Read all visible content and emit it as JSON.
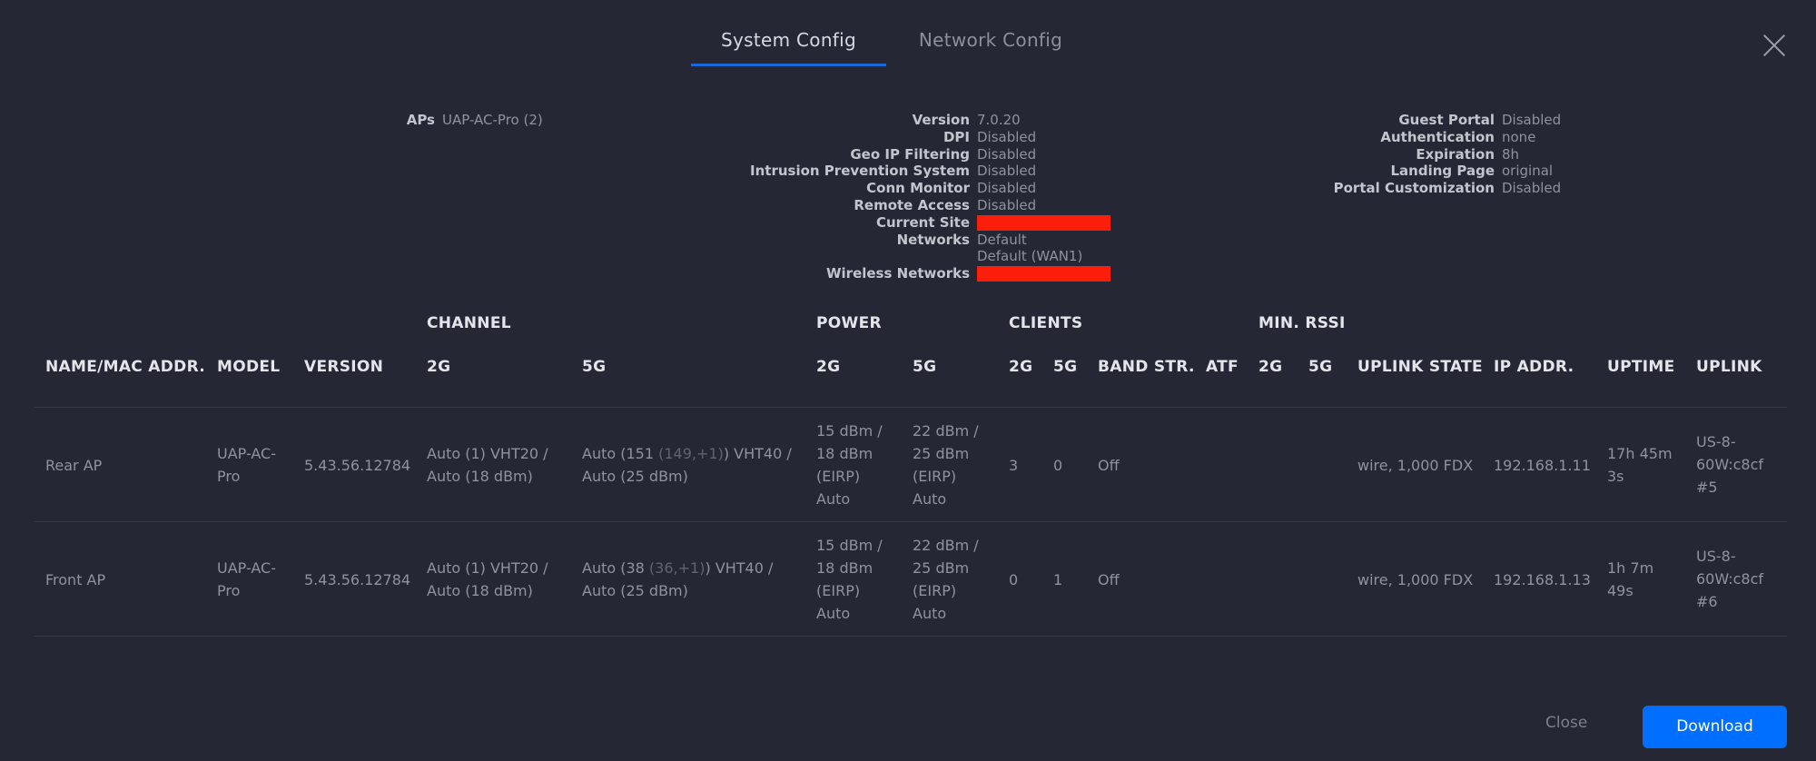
{
  "tabs": [
    {
      "label": "System Config"
    },
    {
      "label": "Network Config"
    }
  ],
  "info": {
    "col1": [
      {
        "label": "APs",
        "value": "UAP-AC-Pro (2)"
      }
    ],
    "col2": [
      {
        "label": "Version",
        "value": "7.0.20"
      },
      {
        "label": "DPI",
        "value": "Disabled"
      },
      {
        "label": "Geo IP Filtering",
        "value": "Disabled"
      },
      {
        "label": "Intrusion Prevention System",
        "value": "Disabled"
      },
      {
        "label": "Conn Monitor",
        "value": "Disabled"
      },
      {
        "label": "Remote Access",
        "value": "Disabled"
      },
      {
        "label": "Current Site",
        "value": ""
      },
      {
        "label": "Networks",
        "value": "Default"
      },
      {
        "label": "",
        "value": "Default (WAN1)"
      },
      {
        "label": "Wireless Networks",
        "value": ""
      }
    ],
    "col3": [
      {
        "label": "Guest Portal",
        "value": "Disabled"
      },
      {
        "label": "Authentication",
        "value": "none"
      },
      {
        "label": "Expiration",
        "value": "8h"
      },
      {
        "label": "Landing Page",
        "value": "original"
      },
      {
        "label": "Portal Customization",
        "value": "Disabled"
      }
    ]
  },
  "table": {
    "groups": {
      "channel": "CHANNEL",
      "power": "POWER",
      "clients": "CLIENTS",
      "min_rssi": "MIN. RSSI"
    },
    "headers": {
      "name": "NAME/MAC ADDR.",
      "model": "MODEL",
      "version": "VERSION",
      "ch2g": "2G",
      "ch5g": "5G",
      "pw2g": "2G",
      "pw5g": "5G",
      "cl2g": "2G",
      "cl5g": "5G",
      "band": "BAND STR.",
      "atf": "ATF",
      "rs2g": "2G",
      "rs5g": "5G",
      "uplink_state": "UPLINK STATE",
      "ip": "IP ADDR.",
      "uptime": "UPTIME",
      "uplink": "UPLINK"
    },
    "rows": [
      {
        "name": "Rear AP",
        "model": [
          "UAP-AC-",
          "Pro"
        ],
        "version": "5.43.56.12784",
        "ch2g": [
          "Auto (1) VHT20  /",
          "Auto (18 dBm)"
        ],
        "ch5g_pre": "Auto (151 ",
        "ch5g_muted": "(149,+1)",
        "ch5g_post": ") VHT40  /",
        "ch5g_l2": "Auto (25 dBm)",
        "pw2g": [
          "15 dBm /",
          "18 dBm",
          "(EIRP)",
          "Auto"
        ],
        "pw5g": [
          "22 dBm /",
          "25 dBm",
          "(EIRP)",
          "Auto"
        ],
        "cl2g": "3",
        "cl5g": "0",
        "band": "Off",
        "uplink_state": "wire, 1,000 FDX",
        "ip": "192.168.1.11",
        "uptime": [
          "17h 45m",
          "3s"
        ],
        "uplink": [
          "US-8-",
          "60W:c8cf",
          "#5"
        ]
      },
      {
        "name": "Front AP",
        "model": [
          "UAP-AC-",
          "Pro"
        ],
        "version": "5.43.56.12784",
        "ch2g": [
          "Auto (1) VHT20  /",
          "Auto (18 dBm)"
        ],
        "ch5g_pre": "Auto (38 ",
        "ch5g_muted": "(36,+1)",
        "ch5g_post": ") VHT40  /",
        "ch5g_l2": "Auto (25 dBm)",
        "pw2g": [
          "15 dBm /",
          "18 dBm",
          "(EIRP)",
          "Auto"
        ],
        "pw5g": [
          "22 dBm /",
          "25 dBm",
          "(EIRP)",
          "Auto"
        ],
        "cl2g": "0",
        "cl5g": "1",
        "band": "Off",
        "uplink_state": "wire, 1,000 FDX",
        "ip": "192.168.1.13",
        "uptime": [
          "1h 7m",
          "49s"
        ],
        "uplink": [
          "US-8-",
          "60W:c8cf",
          "#6"
        ]
      }
    ]
  },
  "buttons": {
    "close": "Close",
    "download": "Download"
  },
  "colors": {
    "accent": "#006fff",
    "tab_underline": "#1b67d8",
    "redaction": "#fb1e0a"
  }
}
